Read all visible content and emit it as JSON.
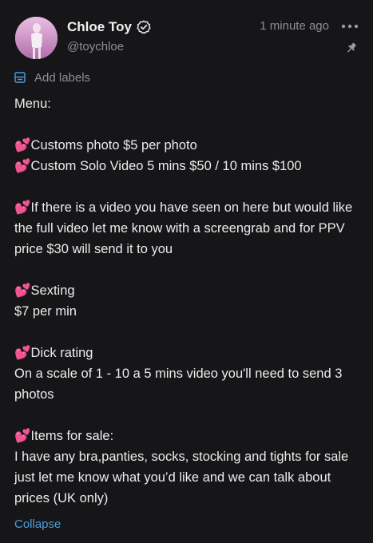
{
  "author": {
    "name": "Chloe Toy",
    "handle": "@toychloe"
  },
  "timestamp": "1 minute ago",
  "labels_action": "Add labels",
  "post": {
    "text": "Menu:\n\n💕Customs photo $5 per photo\n💕Custom Solo Video 5 mins $50 / 10 mins $100\n\n💕If there is a video you have seen on here but would like the full video let me know with a screengrab and for PPV price $30 will send it to you\n\n💕Sexting\n$7 per min\n\n💕Dick rating\nOn a scale of 1 - 10 a 5 mins video you'll need to send 3 photos\n\n💕Items for sale:\nI have any bra,panties, socks, stocking and tights for sale just let me know what you’d like and we can talk about prices (UK only)"
  },
  "collapse_label": "Collapse",
  "icons": {
    "verified": "verified-badge-icon",
    "more": "more-options-icon",
    "pin": "pin-icon",
    "labels": "label-icon"
  },
  "colors": {
    "background": "#161618",
    "text": "#ececec",
    "muted": "#8f8f93",
    "link": "#4a9ee0"
  }
}
